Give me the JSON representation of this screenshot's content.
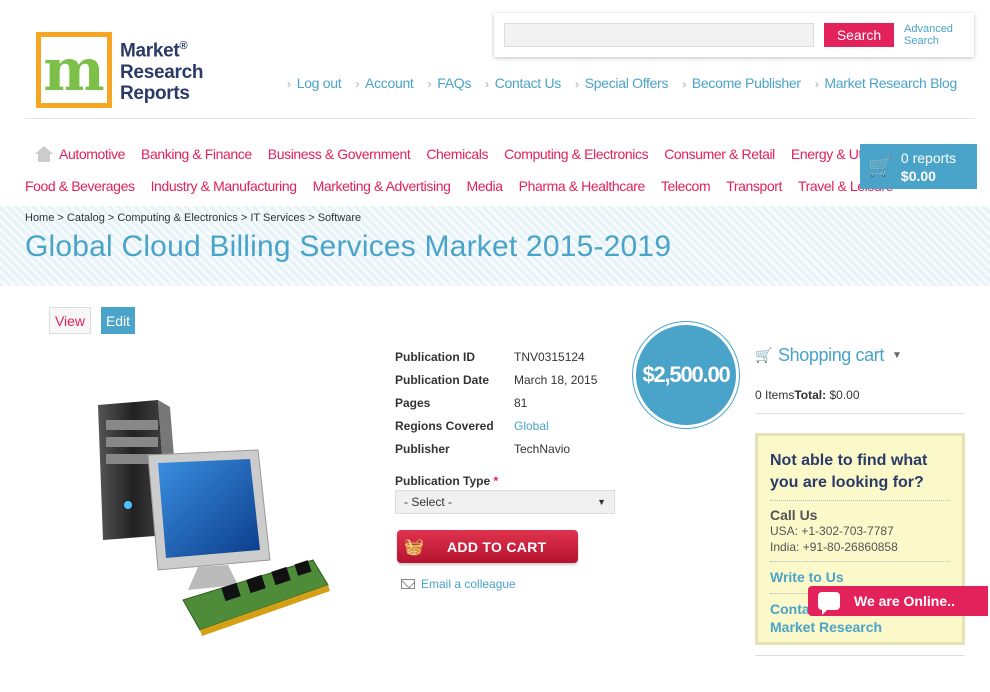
{
  "logo": {
    "line1": "Market",
    "line2": "Research",
    "line3": "Reports",
    "reg": "®",
    "mark": "m"
  },
  "search": {
    "placeholder": "",
    "button": "Search",
    "advanced_line1": "Advanced",
    "advanced_line2": "Search"
  },
  "top_links": [
    "Log out",
    "Account",
    "FAQs",
    "Contact Us",
    "Special Offers",
    "Become Publisher",
    "Market Research Blog"
  ],
  "nav": {
    "row1": [
      "Automotive",
      "Banking & Finance",
      "Business & Government",
      "Chemicals",
      "Computing & Electronics",
      "Consumer & Retail",
      "Energy & Utilities"
    ],
    "row2": [
      "Food & Beverages",
      "Industry & Manufacturing",
      "Marketing & Advertising",
      "Media",
      "Pharma & Healthcare",
      "Telecom",
      "Transport",
      "Travel & Leisure"
    ]
  },
  "cart": {
    "reports": "0 reports",
    "total": "$0.00"
  },
  "breadcrumb": [
    "Home",
    "Catalog",
    "Computing & Electronics",
    "IT Services",
    "Software"
  ],
  "page_title": "Global Cloud Billing Services Market 2015-2019",
  "tabs": {
    "view": "View",
    "edit": "Edit"
  },
  "details": [
    {
      "label": "Publication ID",
      "value": "TNV0315124"
    },
    {
      "label": "Publication Date",
      "value": "March 18, 2015"
    },
    {
      "label": "Pages",
      "value": "81"
    },
    {
      "label": "Regions Covered",
      "value": "Global"
    },
    {
      "label": "Publisher",
      "value": "TechNavio"
    }
  ],
  "publication_type": {
    "label": "Publication Type",
    "required": "*",
    "selected": "- Select -"
  },
  "add_to_cart": "ADD TO CART",
  "email_colleague": "Email a colleague",
  "price": "$2,500.00",
  "shopping_cart": {
    "title": "Shopping cart",
    "items": "0 Items",
    "total_label": "Total:",
    "total_value": "$0.00"
  },
  "help": {
    "title": "Not able to find what you are looking for?",
    "call_us": "Call Us",
    "usa": "USA: +1-302-703-7787",
    "india": "India: +91-80-26860858",
    "write": "Write to Us",
    "contact_line1": "Contact",
    "contact_line2": "Market Research"
  },
  "chat": "We are Online..",
  "colors": {
    "accent_pink": "#e3215a",
    "accent_blue": "#4aa3c9",
    "navy": "#2b3a66",
    "logo_orange": "#f5a623"
  }
}
